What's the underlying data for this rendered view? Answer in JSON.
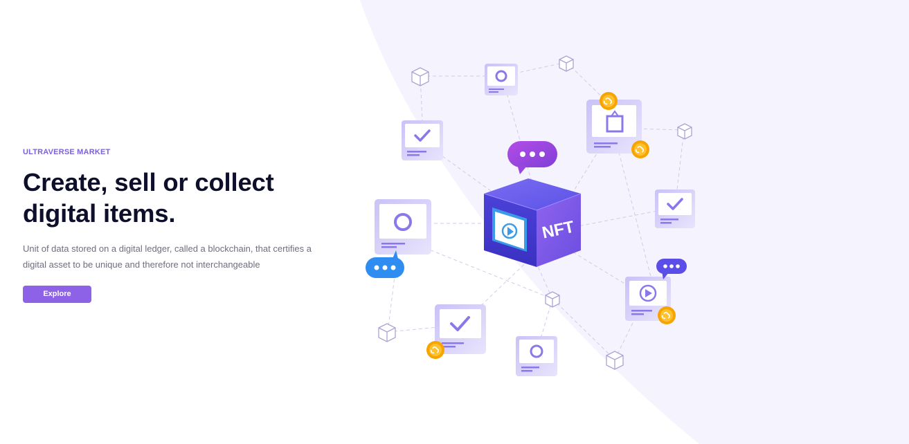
{
  "hero": {
    "eyebrow": "ULTRAVERSE MARKET",
    "title_line1": "Create, sell or collect",
    "title_line2": "digital items.",
    "description_line1": "Unit of data stored on a digital ledger, called a blockchain, that certifies a",
    "description_line2": "digital asset to be unique and therefore not interchangeable",
    "explore_label": "Explore"
  },
  "illustration": {
    "cube_label": "NFT"
  },
  "colors": {
    "accent": "#8d62e6",
    "eyebrow": "#7a62d9",
    "heading": "#0e0f2a",
    "body_text": "#6e6e7e",
    "background_arc": "#f4f2fd",
    "coin": "#f7a400"
  }
}
